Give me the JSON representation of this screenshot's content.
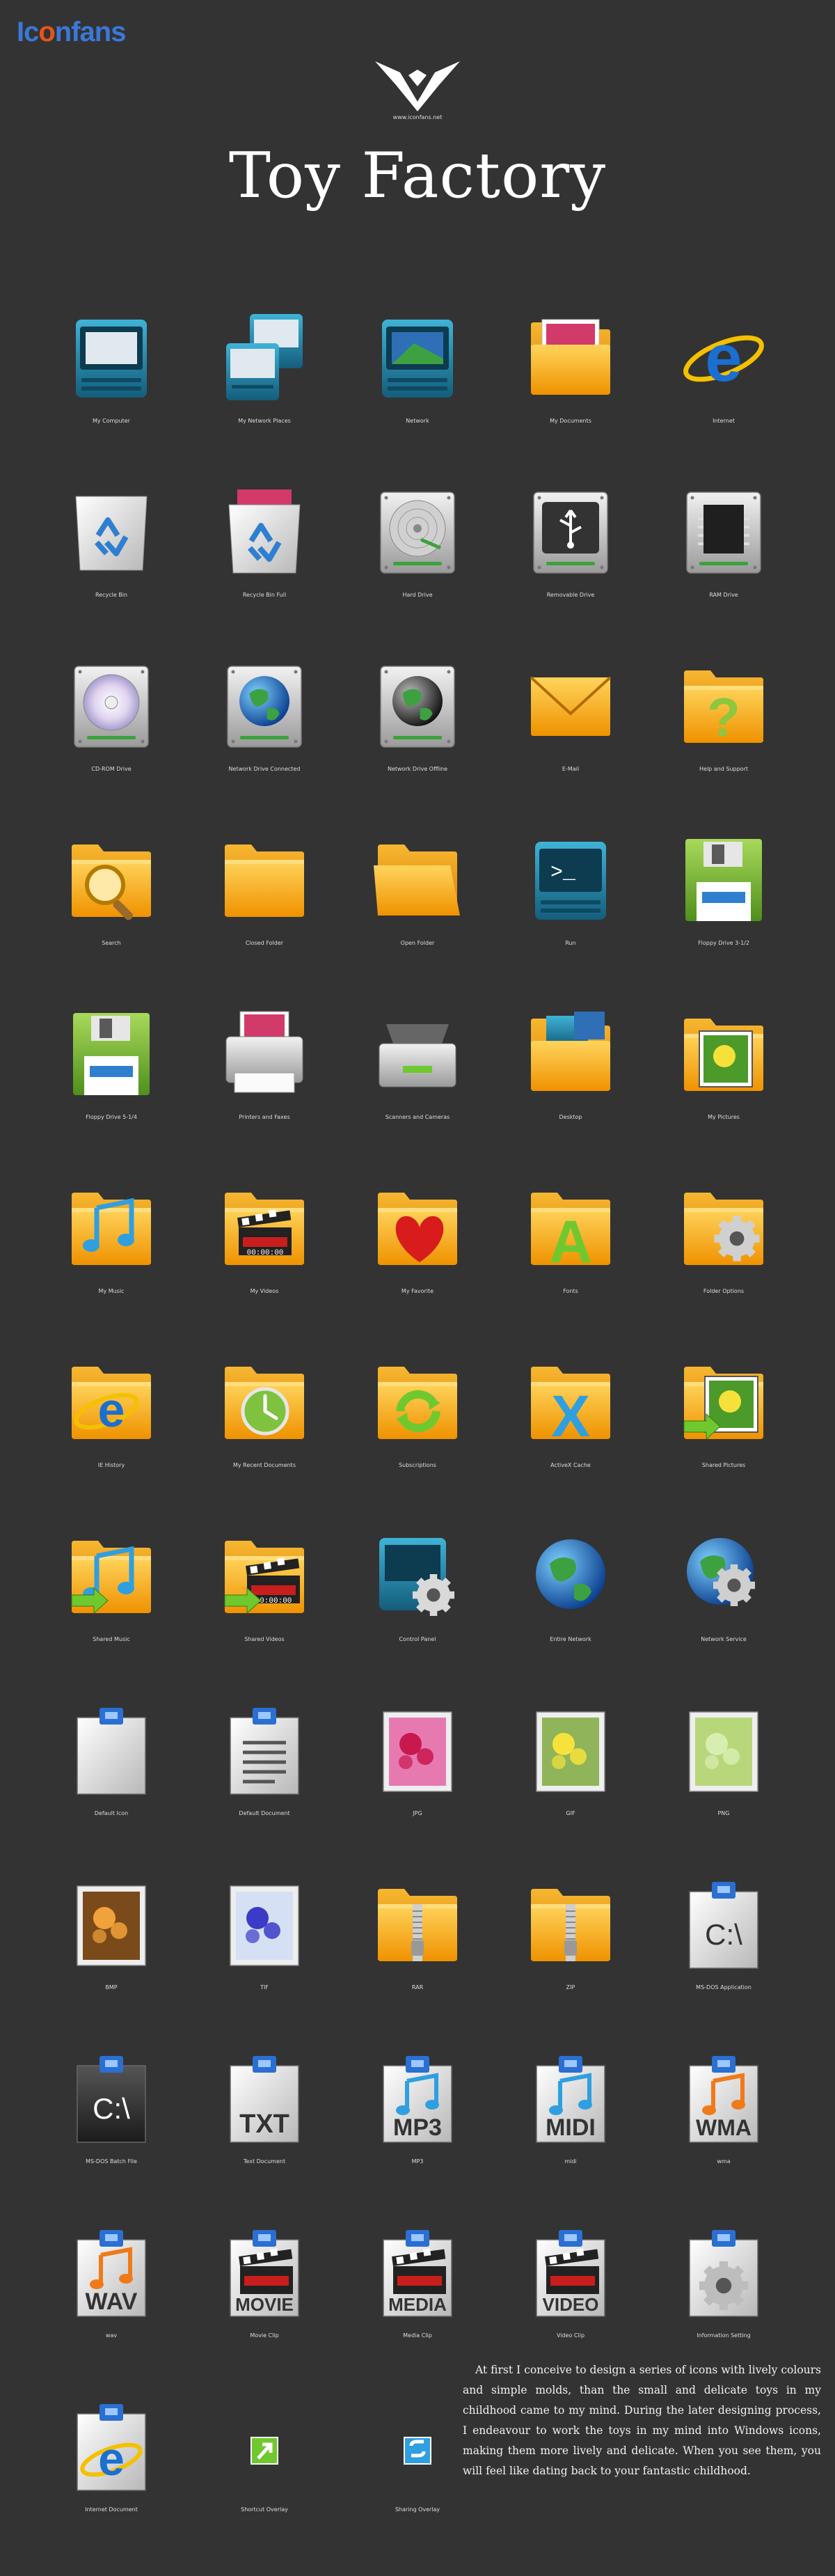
{
  "brand": {
    "name_part1": "Ic",
    "name_part2": "o",
    "name_part3": "nfans"
  },
  "logo": {
    "caption": "www.iconfans.net"
  },
  "title": "Toy Factory",
  "colors": {
    "background": "#333333",
    "folder": "#f4a81c",
    "teal": "#1e7fa3",
    "silver": "#c9c9c9",
    "green": "#8dc63f",
    "brand_blue": "#3a78d8",
    "brand_orange": "#e6541b"
  },
  "icons": [
    {
      "label": "My Computer",
      "kind": "monitor-teal"
    },
    {
      "label": "My Network Places",
      "kind": "monitor-pair"
    },
    {
      "label": "Network",
      "kind": "monitor-globe"
    },
    {
      "label": "My Documents",
      "kind": "folder-photo"
    },
    {
      "label": "Internet",
      "kind": "ie-globe"
    },
    {
      "label": "Recycle Bin",
      "kind": "recycle-empty"
    },
    {
      "label": "Recycle Bin Full",
      "kind": "recycle-full"
    },
    {
      "label": "Hard Drive",
      "kind": "drive-disk"
    },
    {
      "label": "Removable Drive",
      "kind": "drive-usb"
    },
    {
      "label": "RAM Drive",
      "kind": "drive-chip"
    },
    {
      "label": "CD-ROM Drive",
      "kind": "drive-cd"
    },
    {
      "label": "Network Drive Connected",
      "kind": "drive-globe"
    },
    {
      "label": "Network Drive Offline",
      "kind": "drive-globe-dark"
    },
    {
      "label": "E-Mail",
      "kind": "envelope"
    },
    {
      "label": "Help and Support",
      "kind": "folder-question"
    },
    {
      "label": "Search",
      "kind": "folder-search"
    },
    {
      "label": "Closed Folder",
      "kind": "folder"
    },
    {
      "label": "Open Folder",
      "kind": "folder-open"
    },
    {
      "label": "Run",
      "kind": "monitor-terminal"
    },
    {
      "label": "Floppy Drive 3-1/2",
      "kind": "floppy"
    },
    {
      "label": "Floppy Drive 5-1/4",
      "kind": "floppy"
    },
    {
      "label": "Printers and Faxes",
      "kind": "printer"
    },
    {
      "label": "Scanners and Cameras",
      "kind": "scanner"
    },
    {
      "label": "Desktop",
      "kind": "folder-desktop"
    },
    {
      "label": "My Pictures",
      "kind": "folder-picture"
    },
    {
      "label": "My Music",
      "kind": "folder-music"
    },
    {
      "label": "My Videos",
      "kind": "folder-video"
    },
    {
      "label": "My Favorite",
      "kind": "folder-heart"
    },
    {
      "label": "Fonts",
      "kind": "folder-font"
    },
    {
      "label": "Folder Options",
      "kind": "folder-gear"
    },
    {
      "label": "IE History",
      "kind": "folder-ie"
    },
    {
      "label": "My Recent Documents",
      "kind": "folder-clock"
    },
    {
      "label": "Subscriptions",
      "kind": "folder-sync"
    },
    {
      "label": "ActiveX Cache",
      "kind": "folder-x"
    },
    {
      "label": "Shared Pictures",
      "kind": "folder-picture-share"
    },
    {
      "label": "Shared Music",
      "kind": "folder-music-share"
    },
    {
      "label": "Shared Videos",
      "kind": "folder-video-share"
    },
    {
      "label": "Control Panel",
      "kind": "monitor-gear"
    },
    {
      "label": "Entire Network",
      "kind": "globe"
    },
    {
      "label": "Network Service",
      "kind": "globe-gear"
    },
    {
      "label": "Default Icon",
      "kind": "clip-blank"
    },
    {
      "label": "Default Document",
      "kind": "clip-lines"
    },
    {
      "label": "JPG",
      "kind": "photo-pink"
    },
    {
      "label": "GIF",
      "kind": "photo-yellow"
    },
    {
      "label": "PNG",
      "kind": "photo-green"
    },
    {
      "label": "BMP",
      "kind": "photo-orange"
    },
    {
      "label": "TIF",
      "kind": "photo-blue"
    },
    {
      "label": "RAR",
      "kind": "folder-zip"
    },
    {
      "label": "ZIP",
      "kind": "folder-zip"
    },
    {
      "label": "MS-DOS Application",
      "kind": "clip-dos"
    },
    {
      "label": "MS-DOS Batch File",
      "kind": "clip-dos-dark"
    },
    {
      "label": "Text Document",
      "kind": "clip-txt"
    },
    {
      "label": "MP3",
      "kind": "clip-mp3"
    },
    {
      "label": "midi",
      "kind": "clip-midi"
    },
    {
      "label": "wma",
      "kind": "clip-wma"
    },
    {
      "label": "wav",
      "kind": "clip-wav"
    },
    {
      "label": "Movie Clip",
      "kind": "clip-movie"
    },
    {
      "label": "Media Clip",
      "kind": "clip-media"
    },
    {
      "label": "Video Clip",
      "kind": "clip-video"
    },
    {
      "label": "Information Setting",
      "kind": "clip-gear"
    },
    {
      "label": "Internet Document",
      "kind": "clip-ie"
    },
    {
      "label": "Shortcut Overlay",
      "kind": "overlay-shortcut"
    },
    {
      "label": "Sharing Overlay",
      "kind": "overlay-share"
    }
  ],
  "icon_texts": {
    "dos_prompt": "C:\\",
    "txt": "TXT",
    "mp3": "MP3",
    "midi": "MIDI",
    "wma": "WMA",
    "wav": "WAV",
    "movie": "MOVIE",
    "media": "MEDIA",
    "video": "VIDEO",
    "font_letter": "A",
    "question": "?",
    "activex": "X",
    "terminal": ">_",
    "ie_letter": "e",
    "counter": "00:00:00"
  },
  "description": "At first I conceive to design a series of icons with lively colours and simple molds, than the small and delicate toys in my childhood came to my mind. During the later designing process, I endeavour to work the toys in my mind into Windows icons, making them more lively and delicate. When you see them, you will feel like dating back to your fantastic childhood."
}
